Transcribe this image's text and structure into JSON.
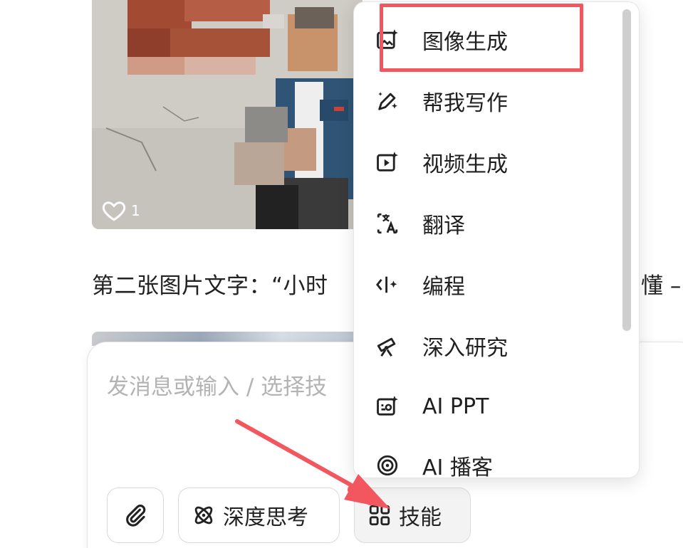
{
  "chat": {
    "like_count": "1",
    "message_text": "第二张图片文字：“小时",
    "message_tail": "懂 –"
  },
  "composer": {
    "placeholder": "发消息或输入 / 选择技",
    "attach_icon": "paperclip-icon",
    "think_label": "深度思考",
    "think_icon": "atom-icon",
    "skills_label": "技能",
    "skills_icon": "grid-icon"
  },
  "skill_menu": {
    "items": [
      {
        "label": "图像生成",
        "icon": "image-sparkle-icon"
      },
      {
        "label": "帮我写作",
        "icon": "pen-sparkle-icon"
      },
      {
        "label": "视频生成",
        "icon": "video-sparkle-icon"
      },
      {
        "label": "翻译",
        "icon": "translate-icon"
      },
      {
        "label": "编程",
        "icon": "code-icon"
      },
      {
        "label": "深入研究",
        "icon": "telescope-icon"
      },
      {
        "label": "AI PPT",
        "icon": "ppt-icon"
      },
      {
        "label": "AI 播客",
        "icon": "podcast-icon"
      }
    ]
  },
  "annotation_colors": {
    "highlight": "#f25760",
    "arrow": "#f25760"
  }
}
